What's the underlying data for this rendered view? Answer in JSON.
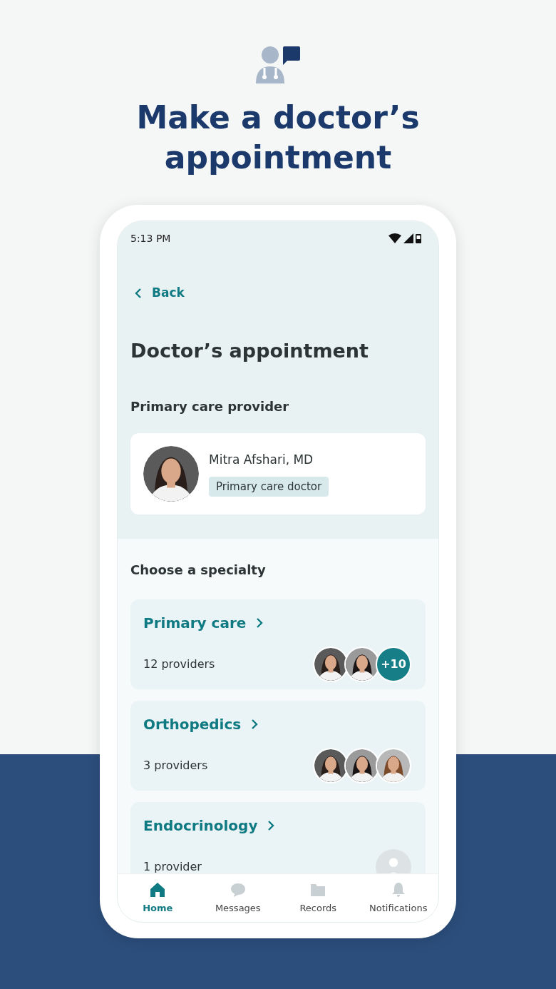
{
  "headline": "Make a doctor’s appointment",
  "status_bar": {
    "time": "5:13 PM"
  },
  "back": {
    "label": "Back"
  },
  "title": "Doctor’s appointment",
  "pcp_section": {
    "heading": "Primary care provider",
    "name": "Mitra Afshari, MD",
    "tag": "Primary care doctor",
    "avatar": {
      "kind": "picture"
    }
  },
  "specialty_section": {
    "heading": "Choose a specialty",
    "cards": [
      {
        "name": "Primary care",
        "count": "12 providers",
        "avatars": [
          {
            "kind": "picture"
          },
          {
            "kind": "picture"
          },
          {
            "kind": "more",
            "text": "+10"
          }
        ]
      },
      {
        "name": "Orthopedics",
        "count": "3 providers",
        "avatars": [
          {
            "kind": "picture"
          },
          {
            "kind": "picture"
          },
          {
            "kind": "picture"
          }
        ]
      },
      {
        "name": "Endocrinology",
        "count": "1 provider",
        "avatars": [
          {
            "kind": "placeholder"
          }
        ]
      }
    ]
  },
  "nav": [
    {
      "label": "Home",
      "kind": "home",
      "selected": true
    },
    {
      "label": "Messages",
      "kind": "messages",
      "selected": false
    },
    {
      "label": "Records",
      "kind": "records",
      "selected": false
    },
    {
      "label": "Notifications",
      "kind": "notifications",
      "selected": false
    }
  ]
}
